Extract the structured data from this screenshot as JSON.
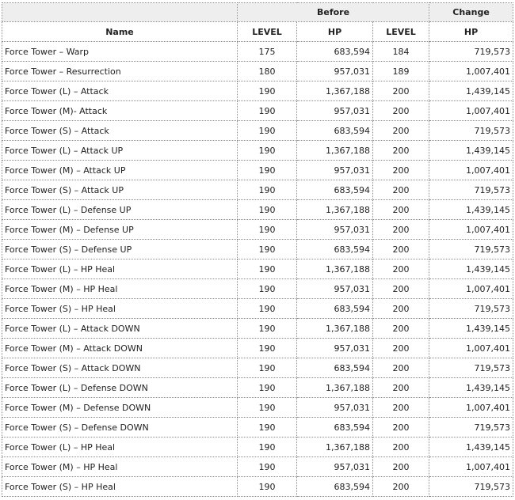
{
  "header": {
    "group_before": "Before",
    "group_change": "Change",
    "col_name": "Name",
    "col_level_before": "LEVEL",
    "col_hp_before": "HP",
    "col_level_change": "LEVEL",
    "col_hp_change": "HP"
  },
  "rows": [
    {
      "name": "Force Tower – Warp",
      "level_before": "175",
      "hp_before": "683,594",
      "level_after": "184",
      "hp_after": "719,573"
    },
    {
      "name": "Force Tower – Resurrection",
      "level_before": "180",
      "hp_before": "957,031",
      "level_after": "189",
      "hp_after": "1,007,401"
    },
    {
      "name": "Force Tower (L) – Attack",
      "level_before": "190",
      "hp_before": "1,367,188",
      "level_after": "200",
      "hp_after": "1,439,145"
    },
    {
      "name": "Force Tower (M)- Attack",
      "level_before": "190",
      "hp_before": "957,031",
      "level_after": "200",
      "hp_after": "1,007,401"
    },
    {
      "name": "Force Tower (S) – Attack",
      "level_before": "190",
      "hp_before": "683,594",
      "level_after": "200",
      "hp_after": "719,573"
    },
    {
      "name": "Force Tower (L) – Attack UP",
      "level_before": "190",
      "hp_before": "1,367,188",
      "level_after": "200",
      "hp_after": "1,439,145"
    },
    {
      "name": "Force Tower (M) – Attack UP",
      "level_before": "190",
      "hp_before": "957,031",
      "level_after": "200",
      "hp_after": "1,007,401"
    },
    {
      "name": "Force Tower (S) – Attack UP",
      "level_before": "190",
      "hp_before": "683,594",
      "level_after": "200",
      "hp_after": "719,573"
    },
    {
      "name": "Force Tower (L) – Defense UP",
      "level_before": "190",
      "hp_before": "1,367,188",
      "level_after": "200",
      "hp_after": "1,439,145"
    },
    {
      "name": "Force Tower (M) – Defense UP",
      "level_before": "190",
      "hp_before": "957,031",
      "level_after": "200",
      "hp_after": "1,007,401"
    },
    {
      "name": "Force Tower (S) – Defense UP",
      "level_before": "190",
      "hp_before": "683,594",
      "level_after": "200",
      "hp_after": "719,573"
    },
    {
      "name": "Force Tower (L) – HP Heal",
      "level_before": "190",
      "hp_before": "1,367,188",
      "level_after": "200",
      "hp_after": "1,439,145"
    },
    {
      "name": "Force Tower (M) – HP Heal",
      "level_before": "190",
      "hp_before": "957,031",
      "level_after": "200",
      "hp_after": "1,007,401"
    },
    {
      "name": "Force Tower (S) – HP Heal",
      "level_before": "190",
      "hp_before": "683,594",
      "level_after": "200",
      "hp_after": "719,573"
    },
    {
      "name": "Force Tower (L) – Attack DOWN",
      "level_before": "190",
      "hp_before": "1,367,188",
      "level_after": "200",
      "hp_after": "1,439,145"
    },
    {
      "name": "Force Tower (M) – Attack DOWN",
      "level_before": "190",
      "hp_before": "957,031",
      "level_after": "200",
      "hp_after": "1,007,401"
    },
    {
      "name": "Force Tower (S) – Attack DOWN",
      "level_before": "190",
      "hp_before": "683,594",
      "level_after": "200",
      "hp_after": "719,573"
    },
    {
      "name": "Force Tower (L) – Defense DOWN",
      "level_before": "190",
      "hp_before": "1,367,188",
      "level_after": "200",
      "hp_after": "1,439,145"
    },
    {
      "name": "Force Tower (M) – Defense DOWN",
      "level_before": "190",
      "hp_before": "957,031",
      "level_after": "200",
      "hp_after": "1,007,401"
    },
    {
      "name": "Force Tower (S) – Defense DOWN",
      "level_before": "190",
      "hp_before": "683,594",
      "level_after": "200",
      "hp_after": "719,573"
    },
    {
      "name": "Force Tower (L) – HP Heal",
      "level_before": "190",
      "hp_before": "1,367,188",
      "level_after": "200",
      "hp_after": "1,439,145"
    },
    {
      "name": "Force Tower (M) – HP Heal",
      "level_before": "190",
      "hp_before": "957,031",
      "level_after": "200",
      "hp_after": "1,007,401"
    },
    {
      "name": "Force Tower (S) – HP Heal",
      "level_before": "190",
      "hp_before": "683,594",
      "level_after": "200",
      "hp_after": "719,573"
    }
  ]
}
